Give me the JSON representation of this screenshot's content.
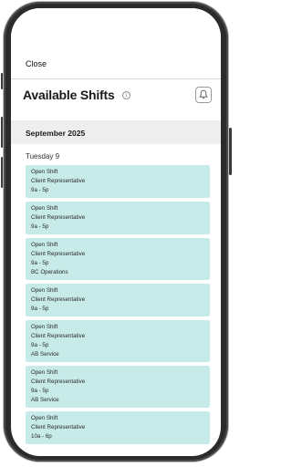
{
  "header": {
    "close_label": "Close",
    "title": "Available Shifts",
    "info_icon": "info-icon",
    "bell_icon": "bell-icon"
  },
  "schedule": {
    "month": "September 2025",
    "day": "Tuesday 9",
    "shifts": [
      {
        "lines": [
          "Open Shift",
          "Client Representative",
          "9a - 5p"
        ]
      },
      {
        "lines": [
          "Open Shift",
          "Client Representative",
          "9a - 5p"
        ]
      },
      {
        "lines": [
          "Open Shift",
          "Client Representative",
          "9a - 5p",
          "BC Operations"
        ]
      },
      {
        "lines": [
          "Open Shift",
          "Client Representative",
          "9a - 5p"
        ]
      },
      {
        "lines": [
          "Open Shift",
          "Client Representative",
          "9a - 5p",
          "AB Service"
        ]
      },
      {
        "lines": [
          "Open Shift",
          "Client Representative",
          "9a - 5p",
          "AB Service"
        ]
      },
      {
        "lines": [
          "Open Shift",
          "Client Representative",
          "10a - 6p"
        ]
      }
    ]
  },
  "colors": {
    "shift_card": "#c7ebe9",
    "month_band": "#eeeeee",
    "frame": "#2b2b2d"
  }
}
